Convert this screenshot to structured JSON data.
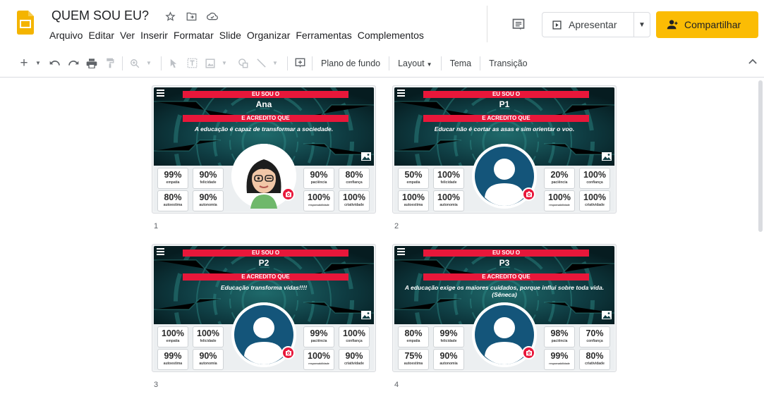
{
  "app": {
    "title": "QUEM SOU EU?",
    "menu": [
      "Arquivo",
      "Editar",
      "Ver",
      "Inserir",
      "Formatar",
      "Slide",
      "Organizar",
      "Ferramentas",
      "Complementos"
    ],
    "present_label": "Apresentar",
    "share_label": "Compartilhar"
  },
  "toolbar": {
    "background_label": "Plano de fundo",
    "layout_label": "Layout",
    "theme_label": "Tema",
    "transition_label": "Transição"
  },
  "colors": {
    "accent_red": "#e8173a",
    "share_yellow": "#fbbc04",
    "avatar_blue": "#14557a",
    "banner_dark": "#0b2f36"
  },
  "slides": [
    {
      "number": "1",
      "heading_top": "EU SOU O",
      "name": "Ana",
      "heading_mid": "E ACREDITO QUE",
      "quote": "A educação é capaz de transformar a sociedade.",
      "avatar": "memoji",
      "stats": [
        {
          "value": "99%",
          "label": "empatia"
        },
        {
          "value": "90%",
          "label": "felicidade"
        },
        {
          "value": "80%",
          "label": "autoestima"
        },
        {
          "value": "90%",
          "label": "autonomia"
        },
        {
          "value": "90%",
          "label": "paciência"
        },
        {
          "value": "80%",
          "label": "confiança"
        },
        {
          "value": "100%",
          "label": "responsabilidade"
        },
        {
          "value": "100%",
          "label": "criatividade"
        }
      ]
    },
    {
      "number": "2",
      "heading_top": "EU SOU O",
      "name": "P1",
      "heading_mid": "E ACREDITO QUE",
      "quote": "Educar não é cortar as asas e sim orientar o voo.",
      "avatar": "placeholder",
      "stats": [
        {
          "value": "50%",
          "label": "empatia"
        },
        {
          "value": "100%",
          "label": "felicidade"
        },
        {
          "value": "100%",
          "label": "autoestima"
        },
        {
          "value": "100%",
          "label": "autonomia"
        },
        {
          "value": "20%",
          "label": "paciência"
        },
        {
          "value": "100%",
          "label": "confiança"
        },
        {
          "value": "100%",
          "label": "responsabilidade"
        },
        {
          "value": "100%",
          "label": "criatividade"
        }
      ]
    },
    {
      "number": "3",
      "heading_top": "EU SOU O",
      "name": "P2",
      "heading_mid": "E ACREDITO QUE",
      "quote": "Educação transforma vidas!!!!",
      "avatar": "placeholder",
      "stats": [
        {
          "value": "100%",
          "label": "empatia"
        },
        {
          "value": "100%",
          "label": "felicidade"
        },
        {
          "value": "99%",
          "label": "autoestima"
        },
        {
          "value": "90%",
          "label": "autonomia"
        },
        {
          "value": "99%",
          "label": "paciência"
        },
        {
          "value": "100%",
          "label": "confiança"
        },
        {
          "value": "100%",
          "label": "responsabilidade"
        },
        {
          "value": "90%",
          "label": "criatividade"
        }
      ]
    },
    {
      "number": "4",
      "heading_top": "EU SOU O",
      "name": "P3",
      "heading_mid": "E ACREDITO QUE",
      "quote": "A educação exige os maiores cuidados, porque influi sobre toda vida. (Sêneca)",
      "avatar": "placeholder",
      "stats": [
        {
          "value": "80%",
          "label": "empatia"
        },
        {
          "value": "99%",
          "label": "felicidade"
        },
        {
          "value": "75%",
          "label": "autoestima"
        },
        {
          "value": "90%",
          "label": "autonomia"
        },
        {
          "value": "98%",
          "label": "paciência"
        },
        {
          "value": "70%",
          "label": "confiança"
        },
        {
          "value": "99%",
          "label": "responsabilidade"
        },
        {
          "value": "80%",
          "label": "criatividade"
        }
      ]
    }
  ]
}
